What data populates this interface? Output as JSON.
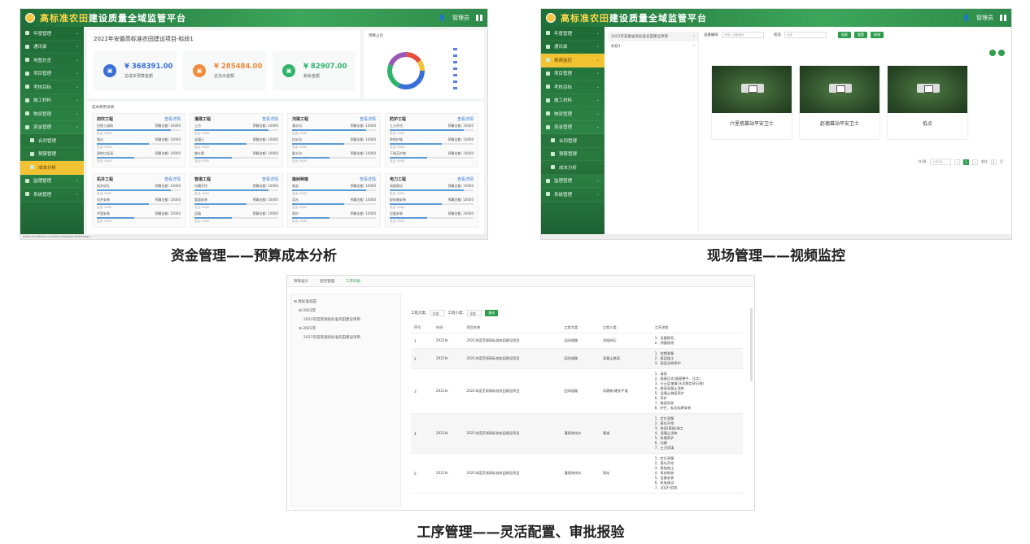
{
  "platform_title_a": "高标准农田",
  "platform_title_b": "建设质量全域监管平台",
  "user": "管理员",
  "captions": {
    "p1": "资金管理——预算成本分析",
    "p2": "现场管理——视频监控",
    "p3": "工序管理——灵活配置、审批报验"
  },
  "panel1": {
    "sidebar": [
      "年度管理",
      "通讯录",
      "地图总览",
      "项目管理",
      "考核目标",
      "施工材料",
      "物资管理",
      "资金管理",
      "合同管理",
      "预算管理",
      "成本分析",
      "监理管理",
      "系统管理"
    ],
    "project_title": "2022年安徽高标准农田建设项目-标段1",
    "stats": [
      {
        "value": "¥ 368391.00",
        "label": "总成本预算金额",
        "color": "#3a6fd8"
      },
      {
        "value": "¥ 285484.00",
        "label": "总支出金额",
        "color": "#f08a3c"
      },
      {
        "value": "¥ 82907.00",
        "label": "剩余金额",
        "color": "#2fb36b"
      }
    ],
    "donut_title": "预算占比",
    "section_title": "成本费用详情",
    "works": [
      {
        "name": "田坎工程",
        "rows": [
          "田埂土填筑",
          "埂沿",
          "建筑垃圾清"
        ]
      },
      {
        "name": "灌溉工程",
        "rows": [
          "土方",
          "混凝土",
          "输水管"
        ]
      },
      {
        "name": "沟渠工程",
        "rows": [
          "灌水沟",
          "排水沟",
          "截水沟"
        ]
      },
      {
        "name": "防护工程",
        "rows": [
          "土方开挖",
          "砖砌护坡",
          "干砌石护坡"
        ]
      },
      {
        "name": "机井工程",
        "rows": [
          "机井成孔",
          "机井安装",
          "井管安装"
        ]
      },
      {
        "name": "管道工程",
        "rows": [
          "沟槽开挖",
          "管道安装",
          "回填"
        ]
      },
      {
        "name": "植树种植",
        "rows": [
          "栽苗",
          "浇水",
          "养护"
        ]
      },
      {
        "name": "电力工程",
        "rows": [
          "线路铺设",
          "配电箱安装",
          "设备安装"
        ]
      }
    ],
    "link_text": "查看详情",
    "budget_label": "预算金额: 10000",
    "spent_label": "支出: 9000",
    "status_url": "https://landtrace.cn/admin/budget/costManage"
  },
  "panel2": {
    "sidebar": [
      "年度管理",
      "通讯录",
      "视频监控",
      "项目管理",
      "考核目标",
      "施工材料",
      "物资管理",
      "资金管理",
      "合同管理",
      "预算管理",
      "成本分析",
      "监理管理",
      "系统管理"
    ],
    "tree": [
      "2022年安徽省高标准农田建设项目",
      "标段1"
    ],
    "filter_label1": "设备编号",
    "filter_placeholder": "请输入设备编号",
    "filter_label2": "状态",
    "filter_select": "全部",
    "btn_search": "搜索",
    "btn_reset": "重置",
    "btn_add": "新增",
    "cameras": [
      "六里塔幕站平安卫士",
      "赵德幕站平安卫士",
      "低点"
    ],
    "pager_total": "共3条",
    "pager_size": "10条/页",
    "pager_page": "1",
    "pager_goto": "前往",
    "pager_pg": "页"
  },
  "panel3": {
    "tabs": [
      "项目设计",
      "巡检管理",
      "工序列表"
    ],
    "tree_root": "高标准农田",
    "tree": [
      {
        "year": "2023年",
        "items": [
          "2023年度芜湖高标准农田建设项目"
        ]
      },
      {
        "year": "2021年",
        "items": [
          "2021年度芜湖高标准农田建设项目"
        ]
      }
    ],
    "filter_label1": "工程大类:",
    "filter_val1": "全部",
    "filter_label2": "工程小类:",
    "filter_val2": "全部",
    "btn_query": "查询",
    "headers": [
      "序号",
      "年份",
      "项目名称",
      "工程大类",
      "工程小类",
      "工序流程"
    ],
    "rows": [
      {
        "no": "1",
        "year": "2021年",
        "name": "2021年度芜湖高标准农田建设项目",
        "big": "田间道路",
        "small": "泥结碎石",
        "steps": [
          "1、设备报验",
          "2、测量放线"
        ]
      },
      {
        "no": "2",
        "year": "2021年",
        "name": "2021年度芜湖高标准农田建设项目",
        "big": "田间道路",
        "small": "混凝土路面",
        "steps": [
          "1、前期准备",
          "2、基层施工",
          "3、面层浇筑养护"
        ]
      },
      {
        "no": "3",
        "year": "2021年",
        "name": "2021年度芜湖高标准农田建设项目",
        "big": "田间道路",
        "small": "机耕路-硬化干道",
        "steps": [
          "1、清表",
          "2、路基压实(路基整平、压实)",
          "3、分土层铺填(水泥稳定碎石铺)",
          "4、路面混凝土浇筑",
          "5、混凝土路面养护",
          "6、养护",
          "7、路面验收",
          "8、护栏、标志标牌安装"
        ]
      },
      {
        "no": "4",
        "year": "2021年",
        "name": "2021年度芜湖高标准农田建设项目",
        "big": "灌溉和排水",
        "small": "渠道",
        "steps": [
          "1、定位测量",
          "2、基坑开挖",
          "3、垫层(基础)施工",
          "4、混凝土浇筑",
          "5、拆模养护",
          "6、勾缝",
          "7、土方回填"
        ]
      },
      {
        "no": "5",
        "year": "2021年",
        "name": "2021年度芜湖高标准农田建设项目",
        "big": "灌溉和排水",
        "small": "泵站",
        "steps": [
          "1、定位测量",
          "2、基坑开挖",
          "3、基础施工",
          "4、泵房砌筑",
          "5、设备安装",
          "6、机电调试",
          "7、试运行验收"
        ]
      }
    ]
  }
}
